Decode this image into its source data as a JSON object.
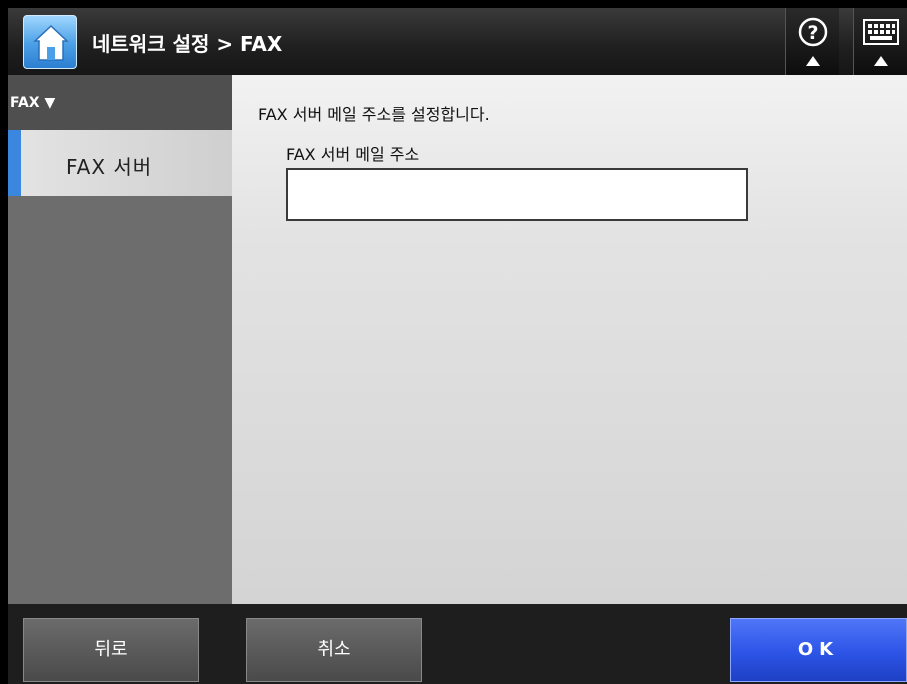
{
  "header": {
    "title": "네트워크 설정 > FAX",
    "home_icon": "home-icon",
    "help_icon": "help-icon",
    "keyboard_icon": "keyboard-icon"
  },
  "sidebar": {
    "section_label": "FAX ▼",
    "items": [
      {
        "label": "FAX 서버",
        "selected": true
      }
    ]
  },
  "main": {
    "description": "FAX 서버 메일 주소를 설정합니다.",
    "field_label": "FAX 서버 메일 주소",
    "field_value": ""
  },
  "footer": {
    "back_label": "뒤로",
    "cancel_label": "취소",
    "ok_label": "OK"
  },
  "colors": {
    "accent": "#3b87e0",
    "ok_button": "#2c54e6"
  }
}
